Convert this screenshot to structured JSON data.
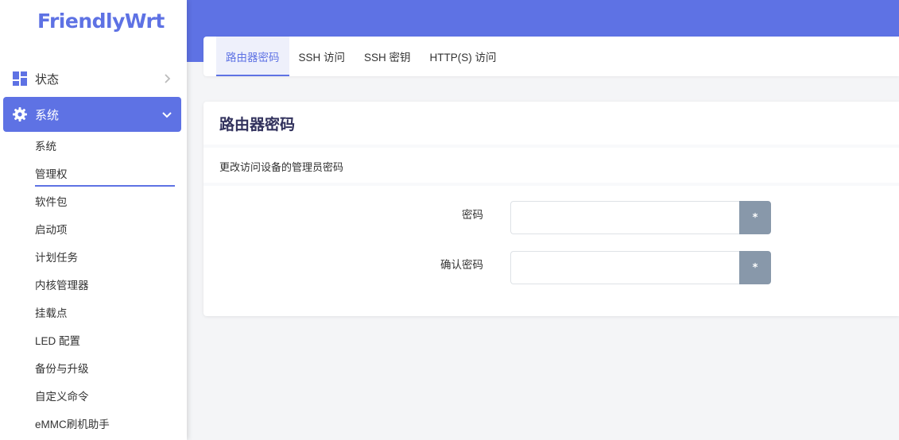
{
  "brand": {
    "logo": "FriendlyWrt"
  },
  "sidebar": {
    "menus": [
      {
        "label": "状态",
        "icon": "dashboard-icon",
        "expanded": false
      },
      {
        "label": "系统",
        "icon": "gear-icon",
        "expanded": true
      }
    ],
    "submenu": [
      {
        "label": "系统"
      },
      {
        "label": "管理权",
        "active": true
      },
      {
        "label": "软件包"
      },
      {
        "label": "启动项"
      },
      {
        "label": "计划任务"
      },
      {
        "label": "内核管理器"
      },
      {
        "label": "挂载点"
      },
      {
        "label": "LED 配置"
      },
      {
        "label": "备份与升级"
      },
      {
        "label": "自定义命令"
      },
      {
        "label": "eMMC刷机助手"
      }
    ]
  },
  "tabs": [
    {
      "label": "路由器密码",
      "active": true
    },
    {
      "label": "SSH 访问"
    },
    {
      "label": "SSH 密钥"
    },
    {
      "label": "HTTP(S) 访问"
    }
  ],
  "card": {
    "title": "路由器密码",
    "description": "更改访问设备的管理员密码",
    "fields": [
      {
        "label": "密码",
        "value": "",
        "toggle_label": "*"
      },
      {
        "label": "确认密码",
        "value": "",
        "toggle_label": "*"
      }
    ]
  },
  "colors": {
    "accent": "#5e72e4",
    "toggle_button": "#8898aa",
    "page_background": "#f4f5f7"
  }
}
